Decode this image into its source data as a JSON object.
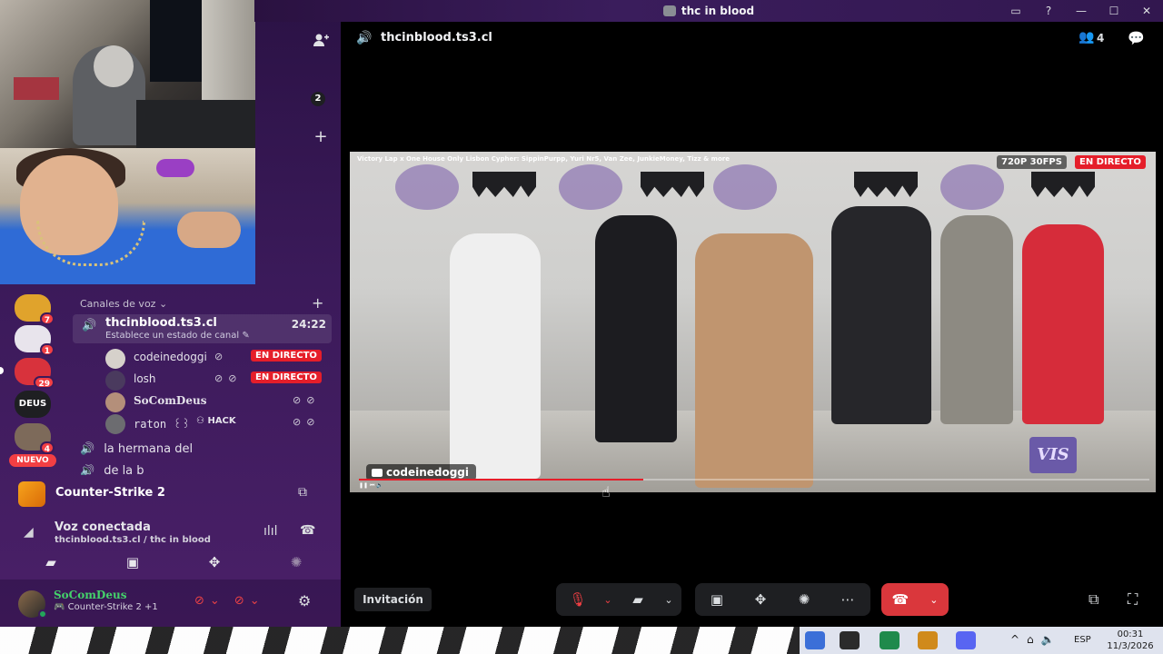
{
  "window": {
    "title": "thc in blood"
  },
  "sidebar": {
    "server_actions": {
      "add_friend": "+",
      "counter": "2"
    },
    "servers": [
      {
        "name": "server-1",
        "badge": "7",
        "color": "#e0a32c"
      },
      {
        "name": "server-2",
        "badge": "1",
        "color": "#e8e4ec"
      },
      {
        "name": "server-3",
        "badge": "29",
        "color": "#d8323c"
      },
      {
        "name": "DEUS",
        "badge": "",
        "color": "#1e1f22"
      },
      {
        "name": "server-5",
        "badge": "4",
        "color": "#7d6a5a"
      }
    ],
    "new_badge": "NUEVO",
    "category": "Canales de voz",
    "active_channel": {
      "name": "thcinblood.ts3.cl",
      "status": "Establece un estado de canal",
      "timer": "24:22"
    },
    "members": [
      {
        "name": "codeinedoggi",
        "live": "EN DIRECTO",
        "avatar_color": "#d6d1cb"
      },
      {
        "name": "losh",
        "live": "EN DIRECTO",
        "avatar_color": "#4a3a5e"
      },
      {
        "name": "SoComDeus",
        "live": "",
        "avatar_color": "#b48f7a"
      },
      {
        "name": "raton ꒰꒱",
        "tag": "HACK",
        "live": "",
        "avatar_color": "#6c6c70"
      }
    ],
    "other_channels": [
      "la hermana del",
      "de la b"
    ],
    "activity": {
      "game": "Counter-Strike 2"
    },
    "voice": {
      "title": "Voz conectada",
      "subtitle": "thcinblood.ts3.cl / thc in blood"
    },
    "user": {
      "name": "SoComDeus",
      "status": "Counter-Strike 2 +1"
    }
  },
  "main": {
    "channel": "thcinblood.ts3.cl",
    "participants": "4",
    "stream": {
      "video_title": "Victory Lap x One House Only Lisbon Cypher: SippinPurpp, Yuri Nr5, Van Zee, JunkieMoney, Tizz & more",
      "quality": "720P 30FPS",
      "live": "EN DIRECTO",
      "streamer": "codeinedoggi",
      "progress": 0.36,
      "watermark": "VIS"
    },
    "invite_label": "Invitación"
  },
  "taskbar": {
    "lang": "ESP",
    "time": "00:31",
    "date": "11/3/2026"
  }
}
